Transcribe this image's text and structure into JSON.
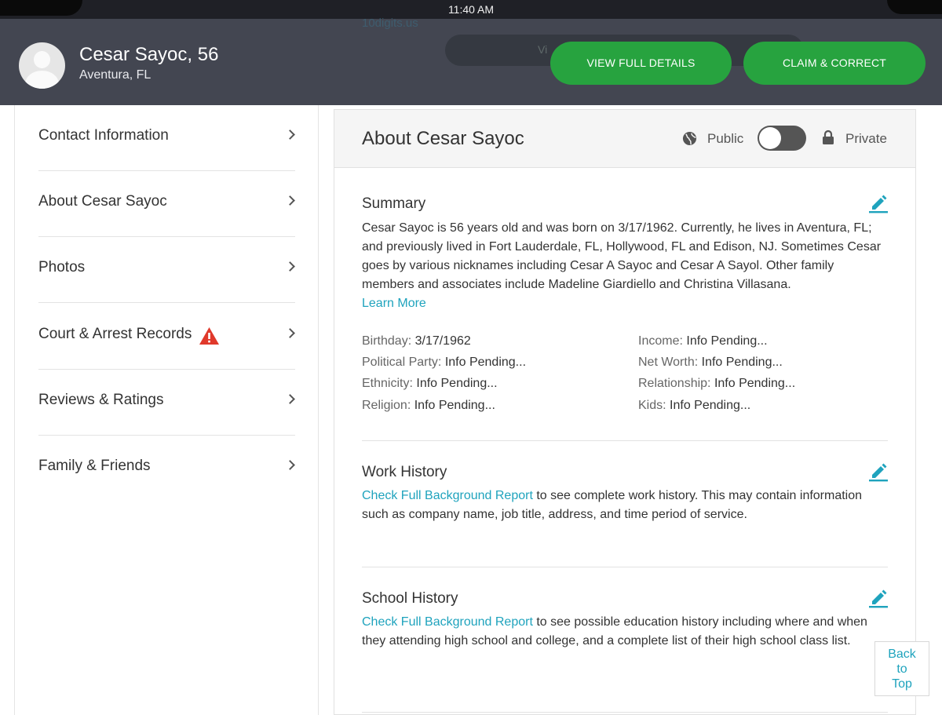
{
  "status_bar": {
    "time": "11:40 AM"
  },
  "header": {
    "name_age": "Cesar Sayoc, 56",
    "location": "Aventura, FL",
    "background_url": "10digits.us",
    "background_button_fragment": "Vi",
    "buttons": {
      "view_full_details": "VIEW FULL DETAILS",
      "claim_correct": "CLAIM & CORRECT"
    }
  },
  "sidebar": {
    "items": [
      {
        "label": "Contact Information"
      },
      {
        "label": "About Cesar Sayoc"
      },
      {
        "label": "Photos"
      },
      {
        "label": "Court & Arrest Records",
        "warning": true
      },
      {
        "label": "Reviews & Ratings"
      },
      {
        "label": "Family & Friends"
      }
    ]
  },
  "card": {
    "title": "About Cesar Sayoc",
    "visibility": {
      "public_label": "Public",
      "private_label": "Private",
      "selected": "public"
    },
    "summary": {
      "title": "Summary",
      "text": "Cesar Sayoc is 56 years old and was born on 3/17/1962. Currently, he lives in Aventura, FL; and previously lived in Fort Lauderdale, FL, Hollywood, FL and Edison, NJ. Sometimes Cesar goes by various nicknames including Cesar A Sayoc and Cesar A Sayol. Other family members and associates include Madeline Giardiello and Christina Villasana.",
      "learn_more": "Learn More"
    },
    "facts_left": [
      {
        "key": "Birthday:",
        "value": "3/17/1962"
      },
      {
        "key": "Political Party:",
        "value": "Info Pending..."
      },
      {
        "key": "Ethnicity:",
        "value": "Info Pending..."
      },
      {
        "key": "Religion:",
        "value": "Info Pending..."
      }
    ],
    "facts_right": [
      {
        "key": "Income:",
        "value": "Info Pending..."
      },
      {
        "key": "Net Worth:",
        "value": "Info Pending..."
      },
      {
        "key": "Relationship:",
        "value": "Info Pending..."
      },
      {
        "key": "Kids:",
        "value": "Info Pending..."
      }
    ],
    "work_history": {
      "title": "Work History",
      "link": "Check Full Background Report",
      "text": " to see complete work history. This may contain information such as company name, job title, address, and time period of service."
    },
    "school_history": {
      "title": "School History",
      "link": "Check Full Background Report",
      "text": " to see possible education history including where and when they attending high school and college, and a complete list of their high school class list."
    }
  },
  "back_to_top": {
    "line1": "Back",
    "line2": "to",
    "line3": "Top"
  },
  "colors": {
    "header_bg": "#434651",
    "accent_green": "#27a33f",
    "link_teal": "#1fa3bd",
    "warning_red": "#e0392b"
  },
  "icons": [
    "avatar-placeholder",
    "chevron-right-icon",
    "warning-icon",
    "globe-icon",
    "lock-icon",
    "pencil-edit-icon"
  ]
}
